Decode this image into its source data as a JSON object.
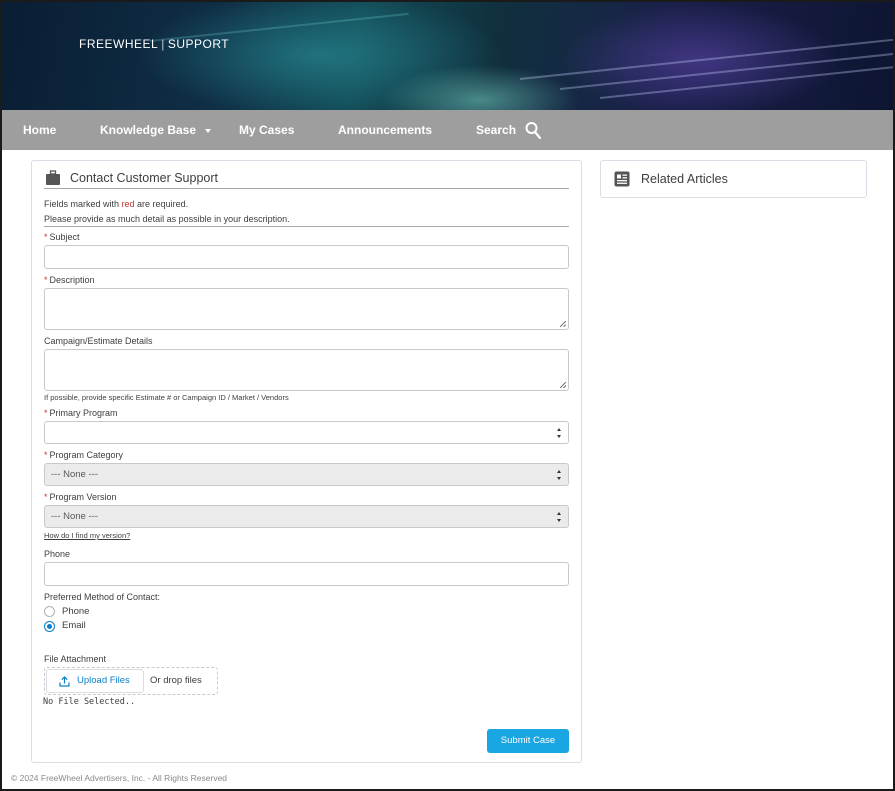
{
  "header": {
    "brand": "FREEWHEEL",
    "brand_suffix": "SUPPORT"
  },
  "nav": {
    "items": [
      {
        "label": "Home"
      },
      {
        "label": "Knowledge Base"
      },
      {
        "label": "My Cases"
      },
      {
        "label": "Announcements"
      },
      {
        "label": "Search"
      }
    ]
  },
  "form": {
    "title": "Contact Customer Support",
    "required_note_prefix": "Fields marked with ",
    "required_note_red": "red",
    "required_note_suffix": " are required.",
    "detail_note": "Please provide as much detail as possible in your description.",
    "fields": {
      "subject": {
        "label": "Subject",
        "value": ""
      },
      "description": {
        "label": "Description",
        "value": ""
      },
      "campaign": {
        "label": "Campaign/Estimate Details",
        "value": "",
        "help": "If possible, provide specific Estimate # or Campaign ID / Market / Vendors"
      },
      "primary_program": {
        "label": "Primary Program",
        "value": ""
      },
      "program_category": {
        "label": "Program Category",
        "value": "--- None ---"
      },
      "program_version": {
        "label": "Program Version",
        "value": "--- None ---",
        "help_link": "How do I find my version?"
      },
      "phone": {
        "label": "Phone",
        "value": ""
      }
    },
    "contact_method": {
      "label": "Preferred Method of Contact:",
      "options": [
        "Phone",
        "Email"
      ],
      "selected": "Email"
    },
    "attachment": {
      "label": "File Attachment",
      "upload_label": "Upload Files",
      "drop_label": "Or drop files",
      "status": "No File Selected.."
    },
    "submit_label": "Submit Case"
  },
  "related": {
    "title": "Related Articles"
  },
  "footer": {
    "text": "© 2024 FreeWheel Advertisers, Inc. - All Rights Reserved"
  },
  "colors": {
    "nav_bg": "#9e9e9e",
    "accent": "#1aa6e3",
    "required": "#c23934",
    "link": "#0b7fc7"
  }
}
